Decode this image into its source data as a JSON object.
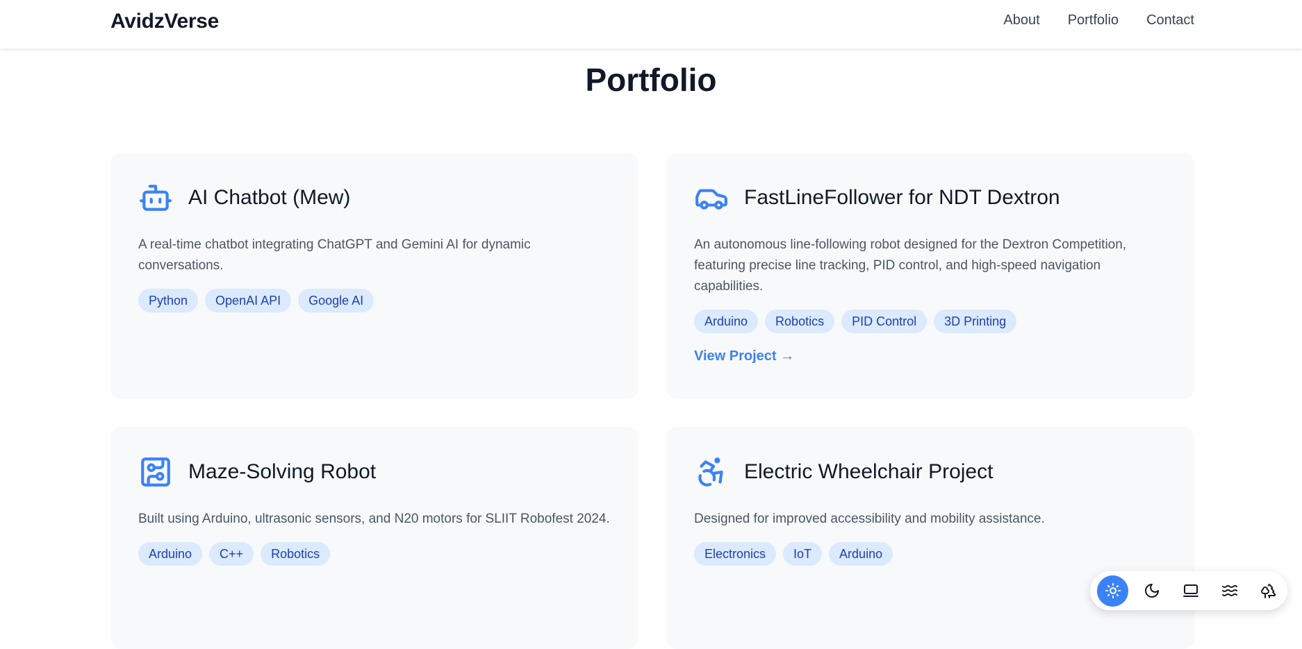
{
  "header": {
    "brand": "AvidzVerse",
    "nav": [
      {
        "label": "About"
      },
      {
        "label": "Portfolio"
      },
      {
        "label": "Contact"
      }
    ]
  },
  "main": {
    "title": "Portfolio",
    "accent_color": "#3b82f6",
    "projects": [
      {
        "icon": "robot-icon",
        "title": "AI Chatbot (Mew)",
        "description": "A real-time chatbot integrating ChatGPT and Gemini AI for dynamic conversations.",
        "tags": [
          "Python",
          "OpenAI API",
          "Google AI"
        ]
      },
      {
        "icon": "car-icon",
        "title": "FastLineFollower for NDT Dextron",
        "description": "An autonomous line-following robot designed for the Dextron Competition, featuring precise line tracking, PID control, and high-speed navigation capabilities.",
        "tags": [
          "Arduino",
          "Robotics",
          "PID Control",
          "3D Printing"
        ],
        "link": "View Project →"
      },
      {
        "icon": "circuit-board-icon",
        "title": "Maze-Solving Robot",
        "description": "Built using Arduino, ultrasonic sensors, and N20 motors for SLIIT Robofest 2024.",
        "tags": [
          "Arduino",
          "C++",
          "Robotics"
        ]
      },
      {
        "icon": "wheelchair-icon",
        "title": "Electric Wheelchair Project",
        "description": "Designed for improved accessibility and mobility assistance.",
        "tags": [
          "Electronics",
          "IoT",
          "Arduino"
        ]
      }
    ]
  },
  "theme_switcher": {
    "options": [
      "sun-icon",
      "moon-icon",
      "laptop-icon",
      "waves-icon",
      "trees-icon"
    ],
    "active": "sun-icon"
  }
}
